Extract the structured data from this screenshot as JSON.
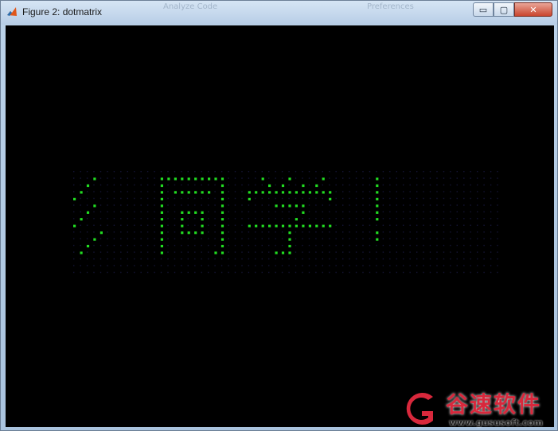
{
  "window": {
    "title": "Figure 2: dotmatrix",
    "background_ghost_texts": [
      "Analyze Code",
      "Preferences"
    ],
    "controls": {
      "minimize": "▭",
      "maximize": "▢",
      "close": "✕"
    }
  },
  "figure": {
    "background": "#000000",
    "lit_color": "#22dd22",
    "dim_color": "#141436",
    "grid_cols": 64,
    "grid_rows": 16,
    "lit_cells": [
      [
        3,
        1
      ],
      [
        13,
        1
      ],
      [
        14,
        1
      ],
      [
        15,
        1
      ],
      [
        16,
        1
      ],
      [
        17,
        1
      ],
      [
        18,
        1
      ],
      [
        19,
        1
      ],
      [
        20,
        1
      ],
      [
        21,
        1
      ],
      [
        22,
        1
      ],
      [
        28,
        1
      ],
      [
        32,
        1
      ],
      [
        37,
        1
      ],
      [
        45,
        1
      ],
      [
        2,
        2
      ],
      [
        13,
        2
      ],
      [
        22,
        2
      ],
      [
        29,
        2
      ],
      [
        31,
        2
      ],
      [
        34,
        2
      ],
      [
        36,
        2
      ],
      [
        45,
        2
      ],
      [
        1,
        3
      ],
      [
        13,
        3
      ],
      [
        15,
        3
      ],
      [
        16,
        3
      ],
      [
        17,
        3
      ],
      [
        18,
        3
      ],
      [
        19,
        3
      ],
      [
        20,
        3
      ],
      [
        22,
        3
      ],
      [
        26,
        3
      ],
      [
        27,
        3
      ],
      [
        28,
        3
      ],
      [
        29,
        3
      ],
      [
        30,
        3
      ],
      [
        31,
        3
      ],
      [
        32,
        3
      ],
      [
        33,
        3
      ],
      [
        34,
        3
      ],
      [
        35,
        3
      ],
      [
        36,
        3
      ],
      [
        37,
        3
      ],
      [
        38,
        3
      ],
      [
        45,
        3
      ],
      [
        0,
        4
      ],
      [
        13,
        4
      ],
      [
        22,
        4
      ],
      [
        26,
        4
      ],
      [
        38,
        4
      ],
      [
        45,
        4
      ],
      [
        3,
        5
      ],
      [
        13,
        5
      ],
      [
        22,
        5
      ],
      [
        30,
        5
      ],
      [
        31,
        5
      ],
      [
        32,
        5
      ],
      [
        33,
        5
      ],
      [
        34,
        5
      ],
      [
        45,
        5
      ],
      [
        2,
        6
      ],
      [
        13,
        6
      ],
      [
        16,
        6
      ],
      [
        17,
        6
      ],
      [
        18,
        6
      ],
      [
        19,
        6
      ],
      [
        22,
        6
      ],
      [
        34,
        6
      ],
      [
        45,
        6
      ],
      [
        1,
        7
      ],
      [
        13,
        7
      ],
      [
        16,
        7
      ],
      [
        19,
        7
      ],
      [
        22,
        7
      ],
      [
        33,
        7
      ],
      [
        45,
        7
      ],
      [
        0,
        8
      ],
      [
        13,
        8
      ],
      [
        16,
        8
      ],
      [
        19,
        8
      ],
      [
        22,
        8
      ],
      [
        26,
        8
      ],
      [
        27,
        8
      ],
      [
        28,
        8
      ],
      [
        29,
        8
      ],
      [
        30,
        8
      ],
      [
        31,
        8
      ],
      [
        32,
        8
      ],
      [
        33,
        8
      ],
      [
        34,
        8
      ],
      [
        35,
        8
      ],
      [
        36,
        8
      ],
      [
        37,
        8
      ],
      [
        38,
        8
      ],
      [
        4,
        9
      ],
      [
        13,
        9
      ],
      [
        16,
        9
      ],
      [
        17,
        9
      ],
      [
        18,
        9
      ],
      [
        19,
        9
      ],
      [
        22,
        9
      ],
      [
        32,
        9
      ],
      [
        45,
        9
      ],
      [
        3,
        10
      ],
      [
        13,
        10
      ],
      [
        22,
        10
      ],
      [
        32,
        10
      ],
      [
        45,
        10
      ],
      [
        2,
        11
      ],
      [
        13,
        11
      ],
      [
        22,
        11
      ],
      [
        32,
        11
      ],
      [
        1,
        12
      ],
      [
        13,
        12
      ],
      [
        21,
        12
      ],
      [
        22,
        12
      ],
      [
        30,
        12
      ],
      [
        31,
        12
      ],
      [
        32,
        12
      ]
    ]
  },
  "watermark": {
    "text": "谷速软件",
    "url": "www.gususoft.com"
  }
}
